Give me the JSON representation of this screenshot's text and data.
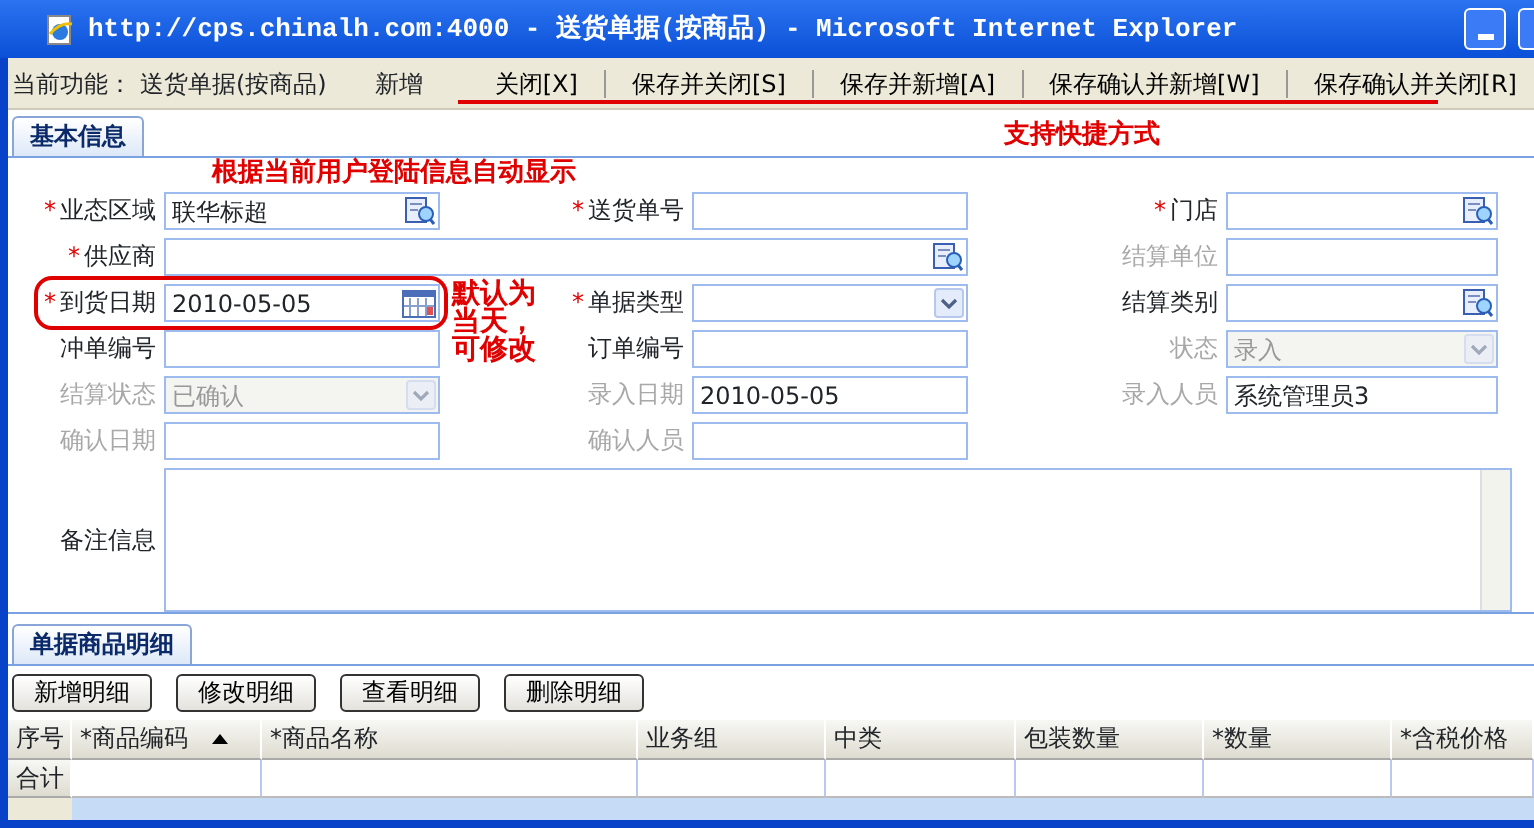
{
  "window": {
    "title": "http://cps.chinalh.com:4000 - 送货单据(按商品) - Microsoft Internet Explorer"
  },
  "toolbar": {
    "label": "当前功能：",
    "function": "送货单据(按商品)",
    "mode": "新增",
    "buttons": [
      "关闭[X]",
      "保存并关闭[S]",
      "保存并新增[A]",
      "保存确认并新增[W]",
      "保存确认并关闭[R]"
    ]
  },
  "main_tab": {
    "label": "基本信息",
    "selected": true
  },
  "form": {
    "rows": [
      [
        {
          "label": "业态区域",
          "required_mark": "*",
          "disabled": false,
          "kind": "lookup",
          "value": "联华标超"
        },
        {
          "label": "送货单号",
          "required_mark": "*",
          "disabled": false,
          "kind": "text"
        },
        {
          "label": "门店",
          "required_mark": "*",
          "disabled": false,
          "kind": "lookup"
        }
      ],
      [
        {
          "label": "供应商",
          "required_mark": "*",
          "disabled": false,
          "kind": "lookup"
        },
        "",
        {
          "label": "结算单位",
          "disabled": true,
          "kind": "text"
        }
      ],
      [
        {
          "label": "到货日期",
          "required_mark": "*",
          "disabled": false,
          "kind": "date",
          "value": "2010-05-05"
        },
        {
          "label": "单据类型",
          "required_mark": "*",
          "disabled": false,
          "kind": "select"
        },
        {
          "label": "结算类别",
          "disabled": false,
          "kind": "lookup"
        }
      ],
      [
        {
          "label": "冲单编号",
          "disabled": false,
          "kind": "text"
        },
        {
          "label": "订单编号",
          "disabled": false,
          "kind": "text"
        },
        {
          "label": "状态",
          "disabled": true,
          "kind": "select",
          "value": "录入"
        }
      ],
      [
        {
          "label": "结算状态",
          "disabled": true,
          "kind": "select",
          "value": "已确认"
        },
        {
          "label": "录入日期",
          "disabled": true,
          "kind": "text",
          "value": "2010-05-05"
        },
        {
          "label": "录入人员",
          "disabled": true,
          "kind": "text",
          "value": "系统管理员3"
        }
      ],
      [
        {
          "label": "确认日期",
          "disabled": true,
          "kind": "text"
        },
        {
          "label": "确认人员",
          "disabled": true,
          "kind": "text"
        }
      ]
    ],
    "remarks": {
      "label": "备注信息"
    }
  },
  "detail_tab": {
    "label": "单据商品明细",
    "selected": true
  },
  "detail_buttons": [
    "新增明细",
    "修改明细",
    "查看明细",
    "删除明细"
  ],
  "table": {
    "columns": [
      {
        "label": "序号"
      },
      {
        "label": "*商品编码",
        "sort_ascending": true
      },
      {
        "label": "*商品名称"
      },
      {
        "label": "业务组"
      },
      {
        "label": "中类"
      },
      {
        "label": "包装数量"
      },
      {
        "label": "*数量"
      },
      {
        "label": "*含税价格"
      }
    ],
    "footer": "合计"
  },
  "annotations": [
    {
      "kind": "shortcut",
      "text": "支持快捷方式"
    },
    {
      "kind": "auto",
      "text": "根据当前用户登陆信息自动显示"
    },
    {
      "kind": "default",
      "text": "默认为当天，可修改"
    }
  ]
}
